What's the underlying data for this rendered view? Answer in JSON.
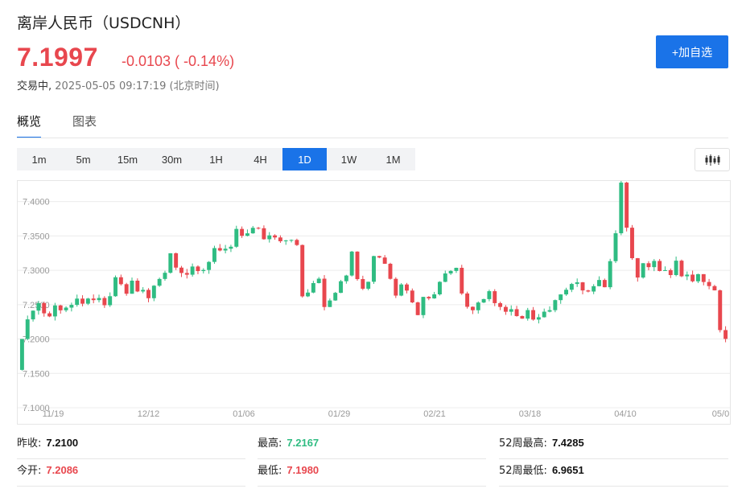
{
  "header": {
    "title": "离岸人民币（USDCNH）",
    "price": "7.1997",
    "change": "-0.0103 ( -0.14%)",
    "status": "交易中,",
    "timestamp": "2025-05-05 09:17:19 (北京时间)",
    "add_button": "+加自选"
  },
  "tabs": [
    {
      "label": "概览",
      "active": true
    },
    {
      "label": "图表",
      "active": false
    }
  ],
  "periods": [
    {
      "label": "1m",
      "active": false
    },
    {
      "label": "5m",
      "active": false
    },
    {
      "label": "15m",
      "active": false
    },
    {
      "label": "30m",
      "active": false
    },
    {
      "label": "1H",
      "active": false
    },
    {
      "label": "4H",
      "active": false
    },
    {
      "label": "1D",
      "active": true
    },
    {
      "label": "1W",
      "active": false
    },
    {
      "label": "1M",
      "active": false
    }
  ],
  "chart_type_icon": "candlestick-icon",
  "colors": {
    "up": "#e8474e",
    "down": "#2fbc82",
    "accent": "#1a73e8"
  },
  "chart_data": {
    "type": "candlestick",
    "ylim": [
      7.1,
      7.43
    ],
    "y_ticks": [
      "7.1000",
      "7.1500",
      "7.2000",
      "7.2500",
      "7.3000",
      "7.3500",
      "7.4000"
    ],
    "x_ticks": [
      "11/19",
      "12/12",
      "01/06",
      "01/29",
      "02/21",
      "03/18",
      "04/10",
      "05/0"
    ],
    "close": [
      7.2001,
      7.2286,
      7.2413,
      7.2522,
      7.2374,
      7.2329,
      7.2489,
      7.2418,
      7.2457,
      7.2497,
      7.2588,
      7.2514,
      7.2589,
      7.2566,
      7.2597,
      7.2492,
      7.2623,
      7.2899,
      7.2798,
      7.2659,
      7.2849,
      7.2692,
      7.2715,
      7.2594,
      7.2776,
      7.2874,
      7.2964,
      7.3248,
      7.3039,
      7.2961,
      7.2936,
      7.3055,
      7.2989,
      7.3005,
      7.3122,
      7.3323,
      7.3288,
      7.3314,
      7.3343,
      7.3602,
      7.3502,
      7.3538,
      7.3618,
      7.3612,
      7.3452,
      7.3508,
      7.3478,
      7.3423,
      7.3434,
      7.3442,
      7.3368,
      7.2621,
      7.2676,
      7.2814,
      7.2878,
      7.2466,
      7.2561,
      7.2672,
      7.2841,
      7.2924,
      7.3272,
      7.2872,
      7.2732,
      7.2833,
      7.3207,
      7.3186,
      7.3095,
      7.2876,
      7.2632,
      7.2794,
      7.2705,
      7.2533,
      7.2348,
      7.2613,
      7.2591,
      7.265,
      7.2832,
      7.2954,
      7.2991,
      7.3036,
      7.2663,
      7.2469,
      7.2419,
      7.2531,
      7.2581,
      7.2696,
      7.2522,
      7.2467,
      7.2397,
      7.2434,
      7.2334,
      7.2297,
      7.2421,
      7.2283,
      7.2317,
      7.2398,
      7.242,
      7.2566,
      7.2649,
      7.2717,
      7.2801,
      7.2825,
      7.2707,
      7.2691,
      7.2769,
      7.2859,
      7.2754,
      7.3133,
      7.3539,
      7.4276,
      7.362,
      7.3176,
      7.2895,
      7.3103,
      7.3046,
      7.3136,
      7.299,
      7.3002,
      7.2931,
      7.314,
      7.2913,
      7.2937,
      7.284,
      7.2944,
      7.283,
      7.277,
      7.2708,
      7.213,
      7.2002
    ],
    "stats": {
      "prev_close_label": "昨收:",
      "prev_close": "7.2100",
      "open_label": "今开:",
      "open": "7.2086",
      "high_label": "最高:",
      "high": "7.2167",
      "low_label": "最低:",
      "low": "7.1980",
      "high52_label": "52周最高:",
      "high52": "7.4285",
      "low52_label": "52周最低:",
      "low52": "6.9651"
    }
  }
}
